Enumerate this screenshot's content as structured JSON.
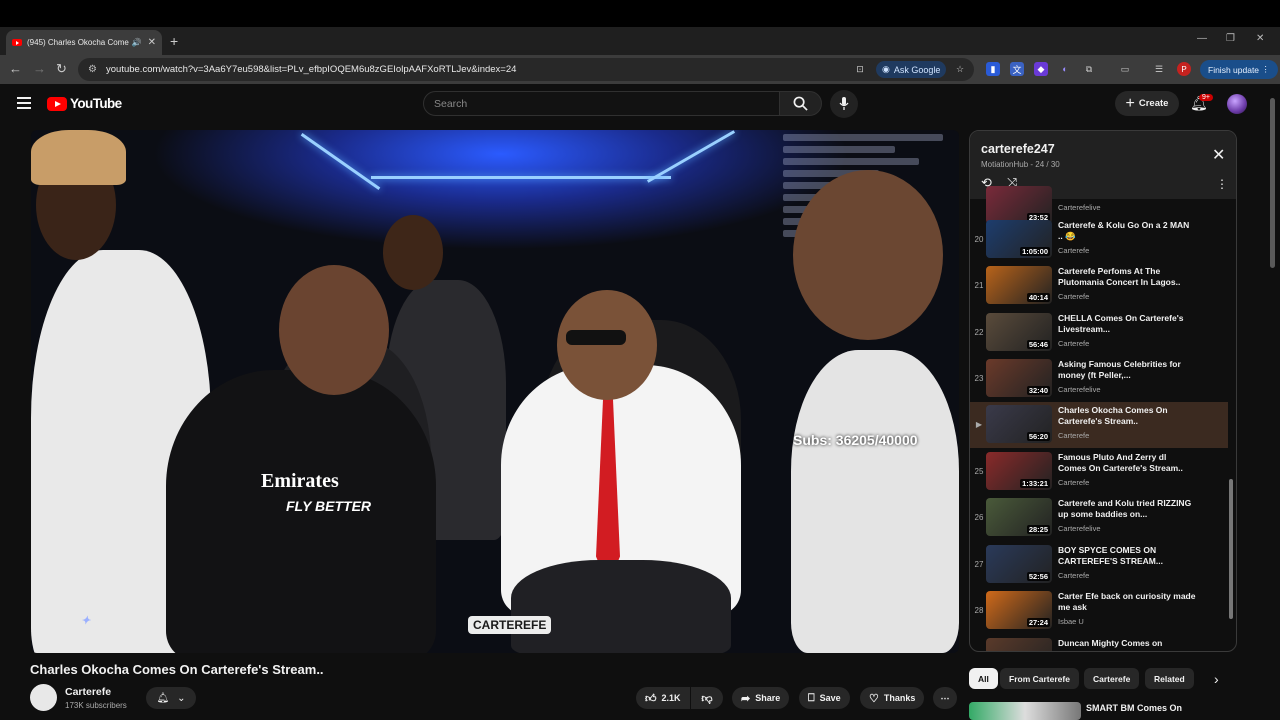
{
  "browser": {
    "tab_title": "(945) Charles Okocha Come",
    "url": "youtube.com/watch?v=3Aa6Y7eu598&list=PLv_efbpIOQEM6u8zGEIolpAAFXoRTLJev&index=24",
    "ask_google": "Ask Google",
    "finish_update": "Finish update",
    "profile_letter": "P"
  },
  "youtube": {
    "logo_text": "YouTube",
    "search_placeholder": "Search",
    "create_label": "Create",
    "notif_badge": "9+"
  },
  "video": {
    "title": "Charles Okocha Comes On Carterefe's Stream..",
    "overlay_subs": "Subs: 36205/40000",
    "watermark": "CARTEREFE",
    "channel_name": "Carterefe",
    "channel_subs": "173K subscribers",
    "likes": "2.1K",
    "share_label": "Share",
    "save_label": "Save",
    "thanks_label": "Thanks"
  },
  "playlist": {
    "title": "carterefe247",
    "subtitle": "MotiationHub - 24 / 30",
    "items": [
      {
        "idx": "",
        "title": "",
        "channel": "Carterefelive",
        "duration": "23:52",
        "thumb": "#7a2a3a"
      },
      {
        "idx": "20",
        "title": "Carterefe & Kolu Go On a 2 MAN .. 😂",
        "channel": "Carterefe",
        "duration": "1:05:00",
        "thumb": "#1d3d6e"
      },
      {
        "idx": "21",
        "title": "Carterefe Perfoms At The Plutomania Concert In Lagos..",
        "channel": "Carterefe",
        "duration": "40:14",
        "thumb": "#b8631a"
      },
      {
        "idx": "22",
        "title": "CHELLA Comes On Carterefe's Livestream...",
        "channel": "Carterefe",
        "duration": "56:46",
        "thumb": "#5a4b3b"
      },
      {
        "idx": "23",
        "title": "Asking Famous Celebrities for money (ft Peller,...",
        "channel": "Carterefelive",
        "duration": "32:40",
        "thumb": "#6b3a2a"
      },
      {
        "idx": "▶",
        "title": "Charles Okocha Comes On Carterefe's Stream..",
        "channel": "Carterefe",
        "duration": "56:20",
        "thumb": "#3a3a4a"
      },
      {
        "idx": "25",
        "title": "Famous Pluto And Zerry dl Comes On Carterefe's Stream..",
        "channel": "Carterefe",
        "duration": "1:33:21",
        "thumb": "#8a2a2a"
      },
      {
        "idx": "26",
        "title": "Carterefe and Kolu tried RIZZING up some baddies on...",
        "channel": "Carterefelive",
        "duration": "28:25",
        "thumb": "#4a5a3a"
      },
      {
        "idx": "27",
        "title": "BOY SPYCE COMES ON CARTEREFE'S STREAM...",
        "channel": "Carterefe",
        "duration": "52:56",
        "thumb": "#2a3a5a"
      },
      {
        "idx": "28",
        "title": "Carter Efe back on curiosity made me ask",
        "channel": "Isbae U",
        "duration": "27:24",
        "thumb": "#d06a1a"
      },
      {
        "idx": "",
        "title": "Duncan Mighty Comes on",
        "channel": "",
        "duration": "",
        "thumb": "#5a3a2a"
      }
    ]
  },
  "chips": [
    "All",
    "From Carterefe",
    "Carterefe",
    "Related"
  ],
  "next_video": {
    "title": "SMART BM Comes On"
  }
}
